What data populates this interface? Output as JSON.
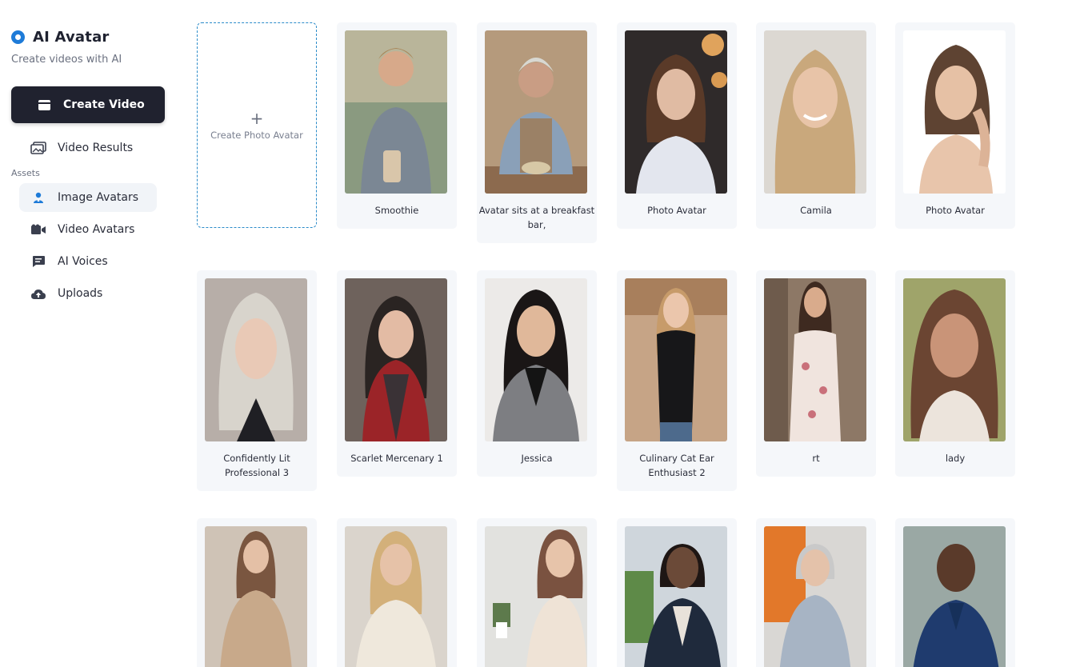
{
  "app": {
    "title": "AI Avatar",
    "subtitle": "Create videos with AI"
  },
  "sidebar": {
    "create_button": "Create Video",
    "video_results": "Video Results",
    "section_label": "Assets",
    "items": [
      {
        "label": "Image Avatars",
        "icon": "person-badge-icon",
        "active": true
      },
      {
        "label": "Video Avatars",
        "icon": "video-camera-icon",
        "active": false
      },
      {
        "label": "AI Voices",
        "icon": "chat-bubble-icon",
        "active": false
      },
      {
        "label": "Uploads",
        "icon": "cloud-upload-icon",
        "active": false
      }
    ]
  },
  "grid": {
    "create_tile": {
      "plus": "+",
      "label": "Create Photo Avatar"
    },
    "avatars": [
      {
        "name": "Smoothie"
      },
      {
        "name": "Avatar sits at a breakfast bar,"
      },
      {
        "name": "Photo Avatar"
      },
      {
        "name": "Camila"
      },
      {
        "name": "Photo Avatar"
      },
      {
        "name": "Confidently Lit Professional 3"
      },
      {
        "name": "Scarlet Mercenary 1"
      },
      {
        "name": "Jessica"
      },
      {
        "name": "Culinary Cat Ear Enthusiast 2"
      },
      {
        "name": "rt"
      },
      {
        "name": "lady"
      },
      {
        "name": ""
      },
      {
        "name": ""
      },
      {
        "name": ""
      },
      {
        "name": ""
      },
      {
        "name": ""
      },
      {
        "name": ""
      }
    ]
  },
  "colors": {
    "accent": "#1e7bd8",
    "button_dark": "#20222f",
    "dashed_border": "#2b8bc9",
    "card_bg": "#f5f7fa"
  }
}
